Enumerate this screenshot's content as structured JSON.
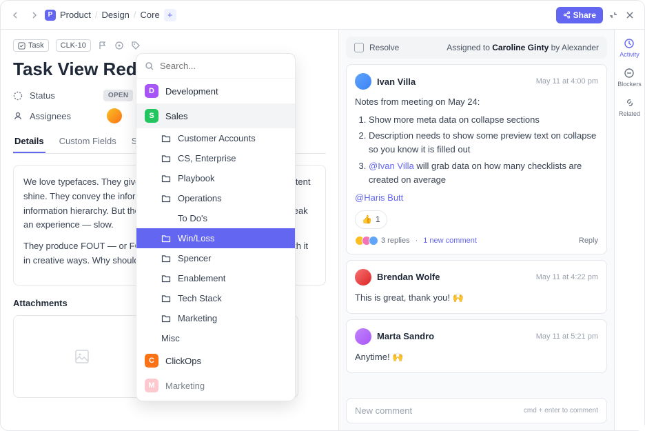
{
  "breadcrumb": {
    "icon_letter": "P",
    "items": [
      "Product",
      "Design",
      "Core"
    ]
  },
  "share_label": "Share",
  "task": {
    "type_label": "Task",
    "id": "CLK-10",
    "title": "Task View Redesign"
  },
  "status": {
    "label": "Status",
    "value": "OPEN"
  },
  "assignees_label": "Assignees",
  "tabs": [
    "Details",
    "Custom Fields",
    "Subtasks"
  ],
  "description": {
    "p1": "We love typefaces. They give our designs a unique voice and let content shine. They convey the information and tell a story. They establish information hierarchy. But they're also functional and can make or break an experience — slow.",
    "p2": "They produce FOUT — or FOIT, or FOFT. And we learned to deal with it in creative ways. Why should we live with that."
  },
  "attachments_label": "Attachments",
  "dropdown": {
    "search_placeholder": "Search...",
    "workspaces": [
      {
        "letter": "D",
        "name": "Development",
        "color": "#a855f7"
      },
      {
        "letter": "S",
        "name": "Sales",
        "color": "#22c55e",
        "active": true
      }
    ],
    "folders": [
      "Customer Accounts",
      "CS, Enterprise",
      "Playbook",
      "Operations"
    ],
    "plain": "To Do's",
    "selected": "Win/Loss",
    "folders2": [
      "Spencer",
      "Enablement",
      "Tech Stack",
      "Marketing"
    ],
    "misc": "Misc",
    "workspaces2": [
      {
        "letter": "C",
        "name": "ClickOps",
        "color": "#f97316"
      },
      {
        "letter": "M",
        "name": "Marketing",
        "color": "#fda4af"
      }
    ]
  },
  "resolve": {
    "label": "Resolve",
    "assigned_prefix": "Assigned to ",
    "assignee": "Caroline Ginty",
    "by": " by Alexander"
  },
  "comments": [
    {
      "author": "Ivan Villa",
      "time": "May 11 at 4:00 pm",
      "intro": "Notes from meeting on May 24:",
      "items": [
        "Show more meta data on collapse sections",
        "Description needs to show some preview text on collapse so you know it is filled out"
      ],
      "item3_mention": "@Ivan Villa",
      "item3_rest": " will grab data on how many checklists are created on average",
      "closing_mention": "@Haris Butt",
      "react_emoji": "👍",
      "react_count": "1",
      "replies": "3 replies",
      "new_replies": "1 new comment",
      "reply_label": "Reply"
    },
    {
      "author": "Brendan Wolfe",
      "time": "May 11 at 4:22 pm",
      "body": "This is great, thank you! 🙌"
    },
    {
      "author": "Marta Sandro",
      "time": "May 11 at 5:21 pm",
      "body": "Anytime! 🙌"
    }
  ],
  "compose": {
    "placeholder": "New comment",
    "hint": "cmd + enter to comment"
  },
  "rail": [
    "Activity",
    "Blockers",
    "Related"
  ]
}
